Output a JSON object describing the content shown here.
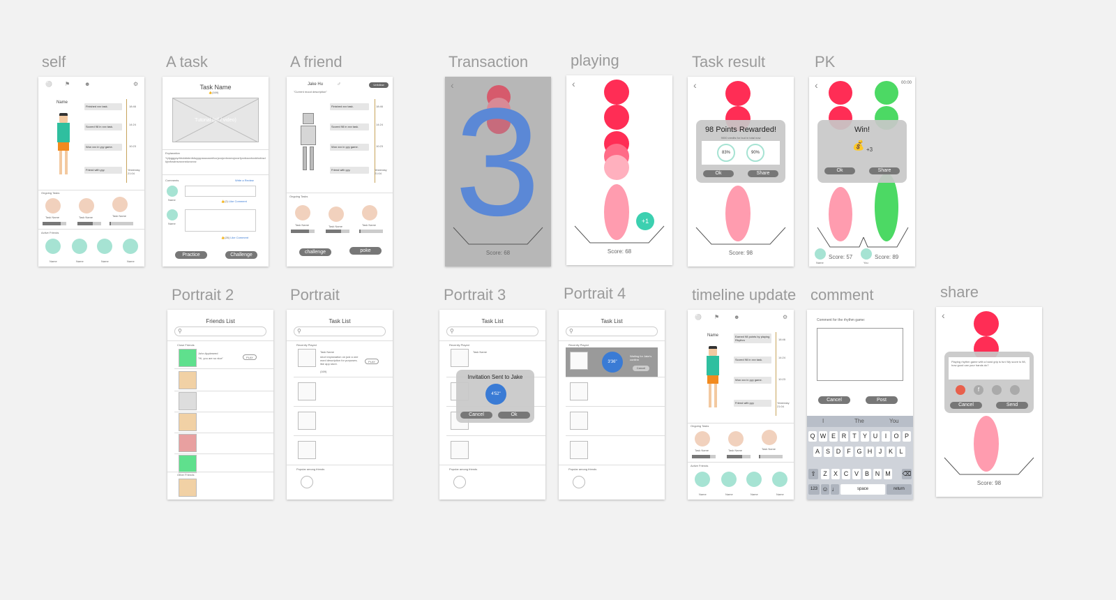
{
  "labels": {
    "self": "self",
    "a_task": "A task",
    "a_friend": "A friend",
    "transaction": "Transaction",
    "playing": "playing",
    "task_result": "Task result",
    "pk": "PK",
    "portrait2": "Portrait 2",
    "portrait": "Portrait",
    "portrait3": "Portrait 3",
    "portrait4": "Portrait 4",
    "timeline_update": "timeline update",
    "comment": "comment",
    "share": "share"
  },
  "self": {
    "name": "Name",
    "times": [
      "18:46",
      "14:24",
      "10:23",
      "Yesterday 21:04"
    ],
    "events": [
      "Finished xxx task.",
      "Scored 98 in xxx task.",
      "Won xxx in yyy game.",
      "Friend with yyy."
    ],
    "ongoing_title": "Ongoing Tasks",
    "task_name": "Task Name",
    "progress": [
      "62%",
      "54%",
      "4%"
    ],
    "active_title": "Active Friends",
    "friend_name": "Name"
  },
  "task": {
    "title": "Task Name",
    "likes": "(169)",
    "media": "Tutorial (gif / video)",
    "explanation_title": "Explanation",
    "explanation": "Yyfygggxyrhhdddnbnfsfuyyppsssxaxerfccrjcxxjcnhxnmcjxxxrfyxxfcsxxhxxkfxxfcsdkjxxfcsdnsvsxxnxkzxzxxz",
    "comments_title": "Comments",
    "write_review": "Write a Review",
    "commenter": "Name",
    "like": "Like",
    "comment": "Comment",
    "practice": "Practice",
    "challenge": "Challenge"
  },
  "friend": {
    "name": "Jake Hu",
    "mood": "\"Current mood description\"",
    "unfollow": "Unfollow",
    "events": [
      "Finished xxx task.",
      "Scored 98 in xxx task.",
      "Won xxx in yyy game.",
      "Friend with yyy."
    ],
    "times": [
      "18:46",
      "14:24",
      "10:23",
      "Yesterday 21:04"
    ],
    "ongoing_title": "Ongoing Tasks",
    "task_name": "Task Name",
    "progress": [
      "62%",
      "54%",
      "4%"
    ],
    "challenge": "challenge",
    "poke": "poke"
  },
  "transaction": {
    "countdown": "3",
    "score": "Score: 68"
  },
  "playing": {
    "plus": "+1",
    "score": "Score: 68"
  },
  "task_result": {
    "title": "98 Points Rewarded!",
    "subtitle": "9000 credits for bud in total now",
    "from": "83%",
    "to": "90%",
    "ok": "Ok",
    "share": "Share",
    "score": "Score: 98"
  },
  "pk": {
    "time": "00:00",
    "win": "Win!",
    "reward": "+3",
    "ok": "Ok",
    "share": "Share",
    "score_left": "Score: 57",
    "score_right": "Score: 89",
    "left_name": "Name",
    "right_name": "You"
  },
  "portrait2": {
    "title": "Friends List",
    "close_friends": "Close Friends",
    "first_friend": "John Appleseed",
    "first_sub": "\"Hi, you are so nice\"",
    "play": "PLAY",
    "other_friends": "Other Friends"
  },
  "portrait": {
    "title": "Task List",
    "recent": "Recently Played",
    "task_name": "Task Name",
    "task_desc": "short explanation on just a one word description for purposes. like app store.",
    "likes": "(169)",
    "play": "PLAY",
    "popular": "Popular among friends"
  },
  "portrait3": {
    "title": "Task List",
    "recent": "Recently Played",
    "task_name": "Task Name",
    "dialog": "Invitation Sent to Jake",
    "timer": "4'52\"",
    "cancel": "Cancel",
    "ok": "Ok",
    "popular": "Popular among friends"
  },
  "portrait4": {
    "title": "Task List",
    "recent": "Recently Played",
    "timer": "3'36\"",
    "waiting": "Waiting for Jake's confirm",
    "cancel": "Cancel",
    "popular": "Popular among friends"
  },
  "timeline": {
    "name": "Name",
    "events": [
      "Earned 98 points by playing Rhythm",
      "Scored 98 in xxx task.",
      "Won xxx in yyy game.",
      "Friend with yyy."
    ],
    "times": [
      "18:46",
      "14:24",
      "10:23",
      "Yesterday 21:04"
    ],
    "ongoing_title": "Ongoing Tasks",
    "task_name": "Task Name",
    "progress": [
      "62%",
      "54%",
      "4%"
    ],
    "active_title": "Active Friends",
    "friend_name": "Name"
  },
  "comment": {
    "prompt": "Comment for the rhythm game:",
    "cancel": "Cancel",
    "post": "Post",
    "suggestions": [
      "I",
      "The",
      "You"
    ],
    "row1": [
      "Q",
      "W",
      "E",
      "R",
      "T",
      "Y",
      "U",
      "I",
      "O",
      "P"
    ],
    "row2": [
      "A",
      "S",
      "D",
      "F",
      "G",
      "H",
      "J",
      "K",
      "L"
    ],
    "row3": [
      "Z",
      "X",
      "C",
      "V",
      "B",
      "N",
      "M"
    ],
    "num": "123",
    "space": "space",
    "return": "return"
  },
  "share": {
    "text": "Playing rhythm game with a hand grip is fun! My score is 98, how good can your hands do?",
    "cancel": "Cancel",
    "send": "Send",
    "score": "Score: 98"
  }
}
